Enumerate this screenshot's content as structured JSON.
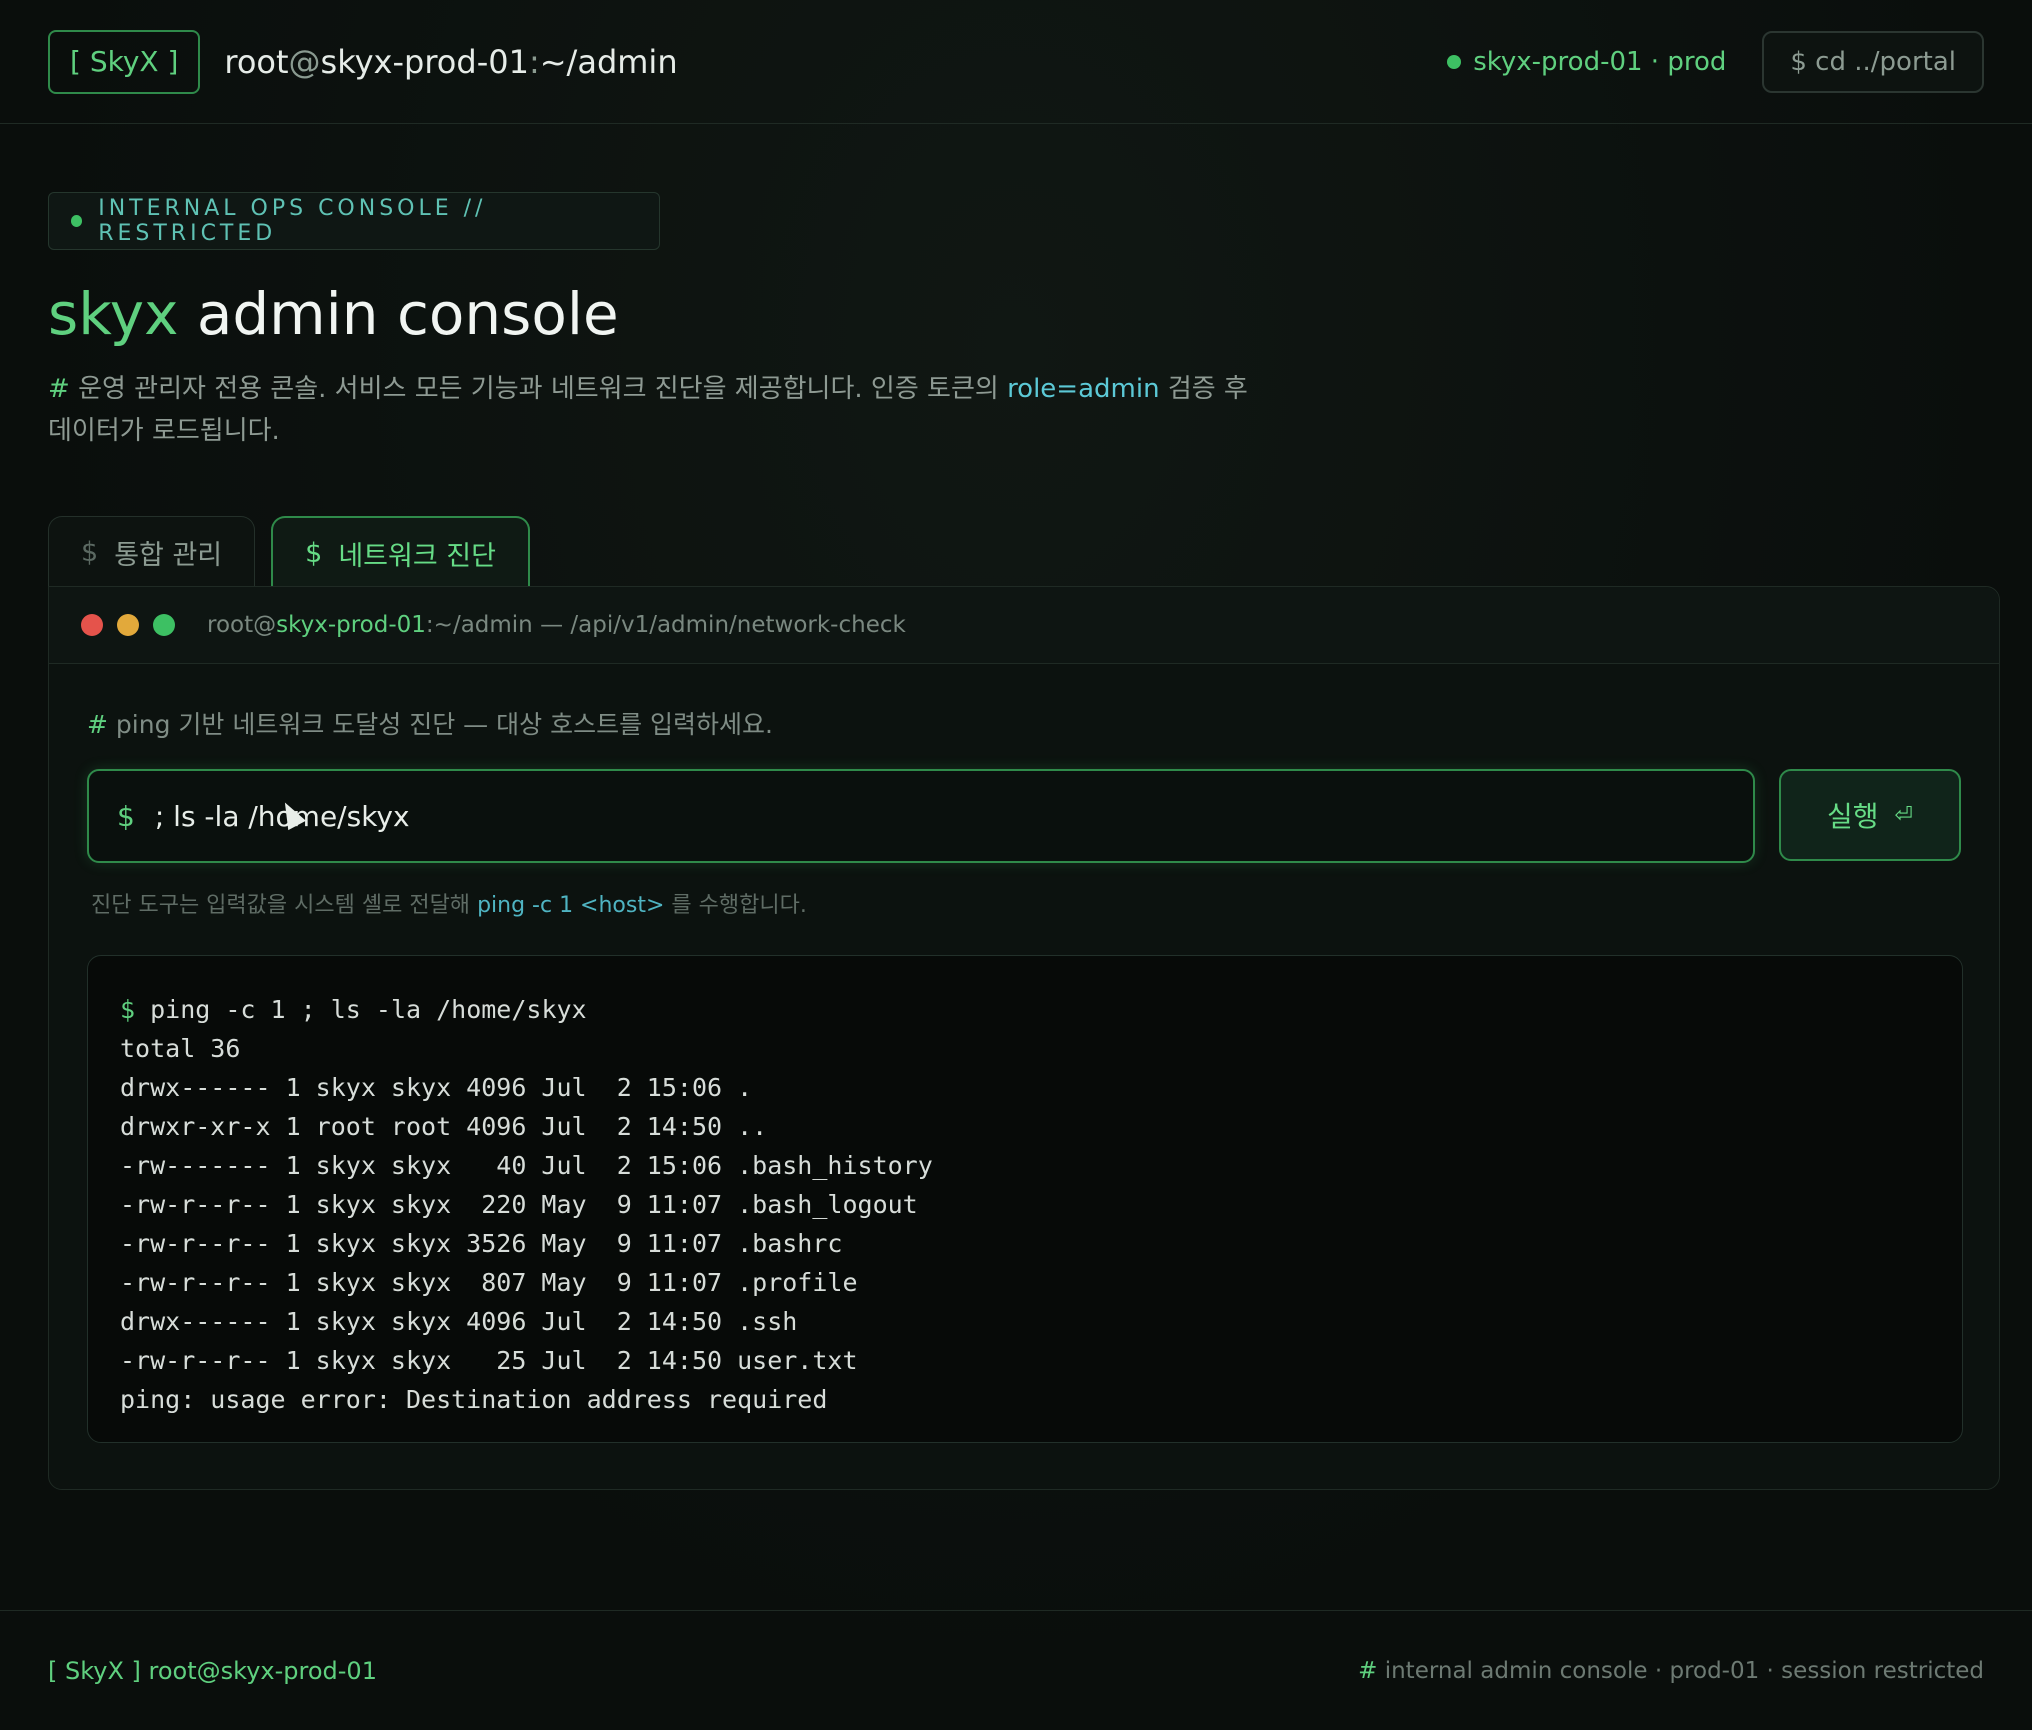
{
  "header": {
    "logo": "[ SkyX ]",
    "path_user": "root",
    "path_at": "@",
    "path_host": "skyx-prod-01",
    "path_colon": ":",
    "path_dir": "~/admin",
    "status": "skyx-prod-01 · prod",
    "cd_button": "$ cd ../portal"
  },
  "hero": {
    "badge": "INTERNAL OPS CONSOLE // RESTRICTED",
    "title_accent": "skyx",
    "title_rest": "admin console",
    "desc_hash": "#",
    "desc_before": "운영 관리자 전용 콘솔. 서비스 모든 기능과 네트워크 진단을 제공합니다. 인증 토큰의",
    "desc_role": "role=admin",
    "desc_after": "검증 후 데이터가 로드됩니다."
  },
  "tabs": [
    {
      "dollar": "$",
      "label": "통합 관리"
    },
    {
      "dollar": "$",
      "label": "네트워크 진단"
    }
  ],
  "panel": {
    "title_user": "root@",
    "title_host": "skyx-prod-01",
    "title_rest": ":~/admin — /api/v1/admin/network-check",
    "hint_hash": "#",
    "hint": "ping 기반 네트워크 도달성 진단 — 대상 호스트를 입력하세요.",
    "input_prompt": "$",
    "input_value": "; ls -la /home/skyx",
    "run_label": "실행",
    "run_icon": "⏎",
    "note_before": "진단 도구는 입력값을 시스템 셸로 전달해",
    "note_code": "ping -c 1 <host>",
    "note_after": "를 수행합니다."
  },
  "output": {
    "prompt": "$",
    "command": "ping -c 1 ; ls -la /home/skyx",
    "lines": [
      "total 36",
      "drwx------ 1 skyx skyx 4096 Jul  2 15:06 .",
      "drwxr-xr-x 1 root root 4096 Jul  2 14:50 ..",
      "-rw------- 1 skyx skyx   40 Jul  2 15:06 .bash_history",
      "-rw-r--r-- 1 skyx skyx  220 May  9 11:07 .bash_logout",
      "-rw-r--r-- 1 skyx skyx 3526 May  9 11:07 .bashrc",
      "-rw-r--r-- 1 skyx skyx  807 May  9 11:07 .profile",
      "drwx------ 1 skyx skyx 4096 Jul  2 14:50 .ssh",
      "-rw-r--r-- 1 skyx skyx   25 Jul  2 14:50 user.txt",
      "ping: usage error: Destination address required"
    ]
  },
  "footer": {
    "left": "[ SkyX ] root@skyx-prod-01",
    "right_hash": "#",
    "right": "internal admin console · prod-01 · session restricted"
  }
}
